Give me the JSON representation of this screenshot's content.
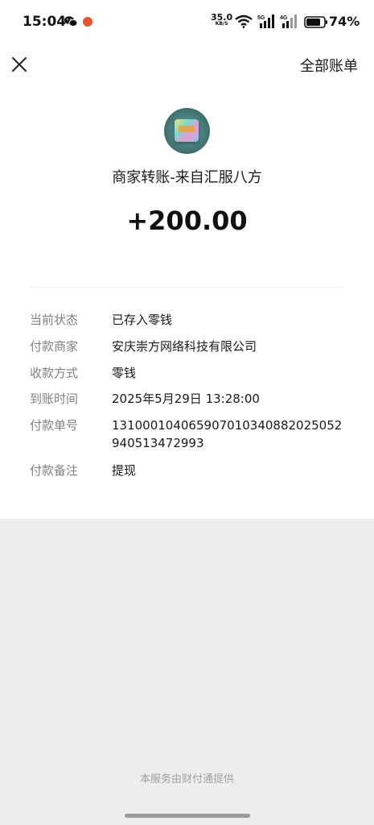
{
  "status_bar": {
    "time": "15:04",
    "net_speed": "35.0",
    "net_speed_unit": "KB/S",
    "sig1_label": "5G",
    "sig2_label": "4G",
    "battery": "74%"
  },
  "nav": {
    "all_bills_label": "全部账单"
  },
  "transaction": {
    "title": "商家转账-来自汇服八方",
    "amount": "+200.00"
  },
  "details": [
    {
      "label": "当前状态",
      "value": "已存入零钱"
    },
    {
      "label": "付款商家",
      "value": "安庆崇方网络科技有限公司"
    },
    {
      "label": "收款方式",
      "value": "零钱"
    },
    {
      "label": "到账时间",
      "value": "2025年5月29日 13:28:00"
    },
    {
      "label": "付款单号",
      "value": "131000104065907010340882025052940513472993"
    },
    {
      "label": "付款备注",
      "value": "提现"
    }
  ],
  "footer": "本服务由财付通提供",
  "icons": {
    "close": "close-icon",
    "wechat": "wechat-icon",
    "wifi": "wifi-icon",
    "signal": "signal-icon",
    "battery": "battery-icon"
  },
  "colors": {
    "page_background": "#ededed",
    "card_background": "#ffffff",
    "label_gray": "#808080",
    "notification_dot": "#e8502e"
  }
}
